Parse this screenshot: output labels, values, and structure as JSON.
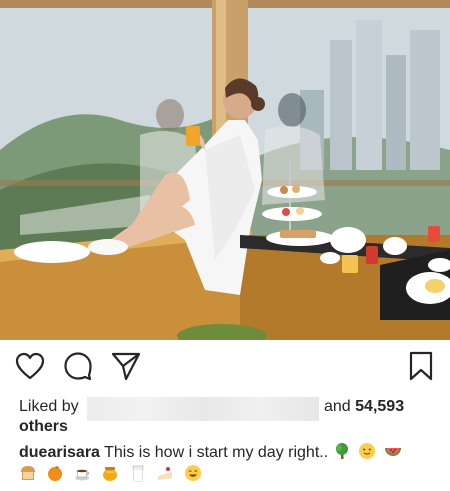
{
  "post": {
    "image_alt": "Woman in white bathrobe sitting on window ledge with breakfast tray",
    "likes": {
      "liked_by_label": "Liked by",
      "and_label": "and",
      "count": "54,593",
      "others_label": "others"
    },
    "caption": {
      "username": "duearisara",
      "text": "This is how i start my day right.."
    }
  },
  "icons": {
    "like": "heart-outline-icon",
    "comment": "comment-bubble-icon",
    "share": "paper-plane-icon",
    "save": "bookmark-outline-icon",
    "caption_line1_emojis": [
      "tree-icon",
      "slightly-smiling-face-icon",
      "watermelon-icon"
    ],
    "caption_line2_emojis": [
      "bread-icon",
      "tangerine-icon",
      "hot-beverage-icon",
      "honey-pot-icon",
      "glass-of-milk-icon",
      "shortcake-icon",
      "smiling-face-icon"
    ]
  },
  "colors": {
    "text": "#262626",
    "background": "#ffffff",
    "redaction": "#ececec"
  }
}
